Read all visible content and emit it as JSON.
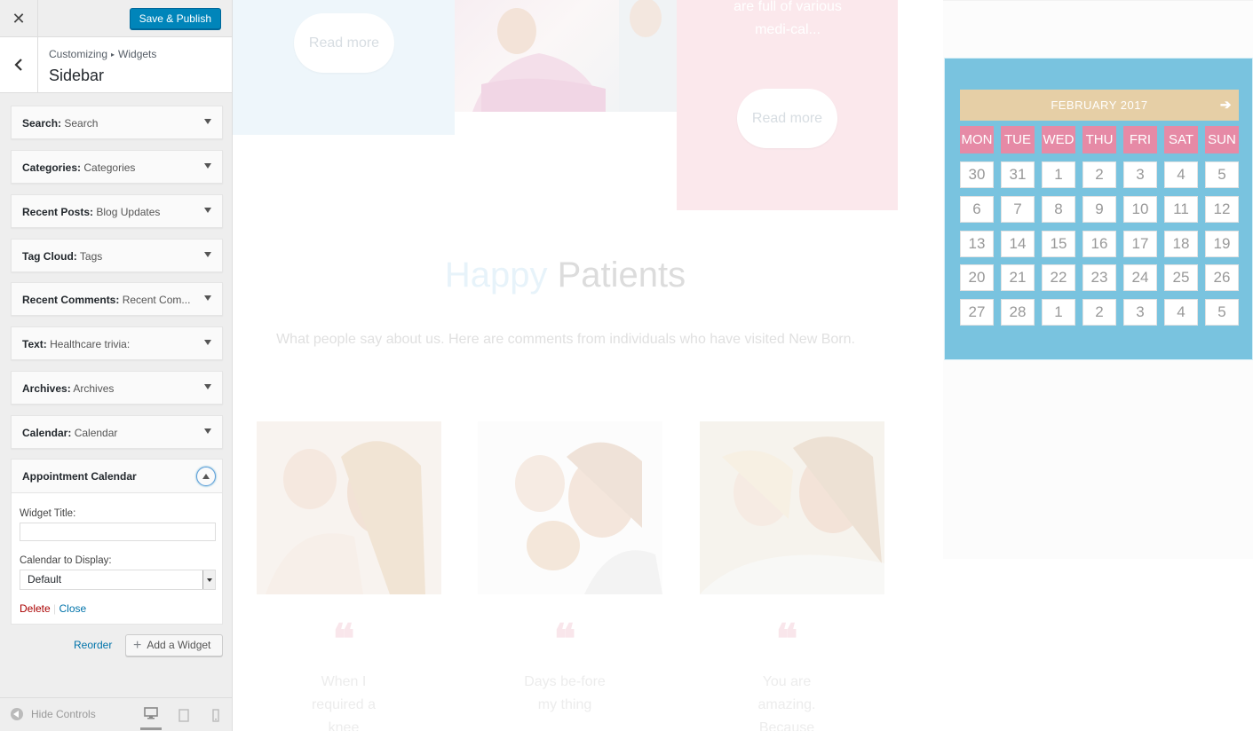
{
  "customizer": {
    "close_glyph": "✕",
    "save_label": "Save & Publish",
    "breadcrumb": [
      "Customizing",
      "Widgets"
    ],
    "breadcrumb_sep": "▸",
    "panel_title": "Sidebar",
    "widgets": [
      {
        "type": "Search:",
        "instance": "Search"
      },
      {
        "type": "Categories:",
        "instance": "Categories"
      },
      {
        "type": "Recent Posts:",
        "instance": "Blog Updates"
      },
      {
        "type": "Tag Cloud:",
        "instance": "Tags"
      },
      {
        "type": "Recent Comments:",
        "instance": "Recent Com..."
      },
      {
        "type": "Text:",
        "instance": "Healthcare trivia:"
      },
      {
        "type": "Archives:",
        "instance": "Archives"
      },
      {
        "type": "Calendar:",
        "instance": "Calendar"
      }
    ],
    "open_widget": {
      "title": "Appointment Calendar",
      "widget_title_label": "Widget Title:",
      "widget_title_value": "",
      "calendar_label": "Calendar to Display:",
      "calendar_value": "Default",
      "delete_label": "Delete",
      "action_sep": "|",
      "close_label": "Close"
    },
    "reorder_label": "Reorder",
    "add_widget_label": "Add a Widget",
    "add_widget_glyph": "+",
    "hide_controls_label": "Hide Controls"
  },
  "preview": {
    "read_more": "Read more",
    "pink_card_text": "are full of various medi-cal...",
    "section_title_word1": "Happy",
    "section_title_word2": "Patients",
    "section_subtitle": "What people say about us. Here are comments from individuals who have visited New Born.",
    "quote_glyph": "❝",
    "testimonials": [
      "When I required a knee",
      "Days be-fore my thing",
      "You are amazing. Because"
    ],
    "calendar": {
      "month_label": "FEBRUARY 2017",
      "next_glyph": "➔",
      "days_of_week": [
        "MON",
        "TUE",
        "WED",
        "THU",
        "FRI",
        "SAT",
        "SUN"
      ],
      "weeks": [
        [
          "30",
          "31",
          "1",
          "2",
          "3",
          "4",
          "5"
        ],
        [
          "6",
          "7",
          "8",
          "9",
          "10",
          "11",
          "12"
        ],
        [
          "13",
          "14",
          "15",
          "16",
          "17",
          "18",
          "19"
        ],
        [
          "20",
          "21",
          "22",
          "23",
          "24",
          "25",
          "26"
        ],
        [
          "27",
          "28",
          "1",
          "2",
          "3",
          "4",
          "5"
        ]
      ]
    }
  },
  "colors": {
    "primary_button": "#0085ba",
    "calendar_bg": "#79c3df",
    "calendar_header": "#e6cfa6",
    "calendar_dow": "#e68aa6",
    "delete_link": "#aa0000",
    "link": "#0073aa"
  }
}
